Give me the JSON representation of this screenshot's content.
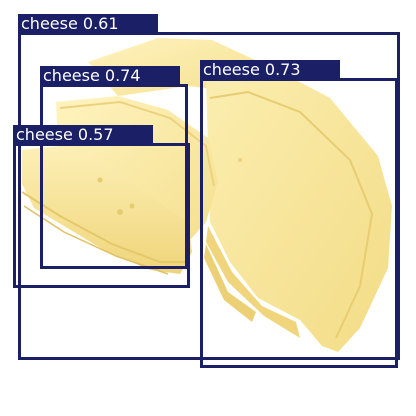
{
  "image": {
    "subject": "cheese-slices-photo"
  },
  "style": {
    "box_color": "#1a1f66",
    "label_text_color": "#ffffff",
    "background": "#ffffff"
  },
  "detections": [
    {
      "label": "cheese 0.61"
    },
    {
      "label": "cheese 0.74"
    },
    {
      "label": "cheese 0.73"
    },
    {
      "label": "cheese 0.57"
    }
  ]
}
